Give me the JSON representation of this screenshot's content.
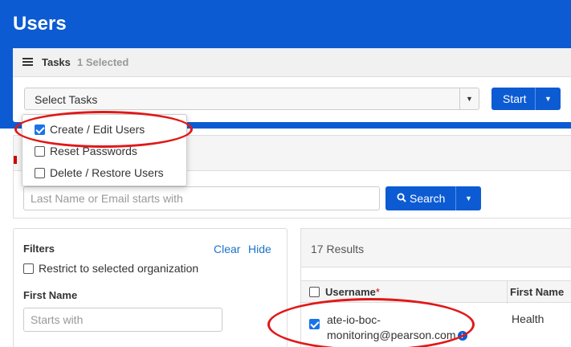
{
  "page": {
    "title": "Users"
  },
  "tasks": {
    "label": "Tasks",
    "selected_count": "1 Selected",
    "select_placeholder": "Select Tasks",
    "start_label": "Start",
    "menu": [
      {
        "label": "Create / Edit Users",
        "checked": true
      },
      {
        "label": "Reset Passwords",
        "checked": false
      },
      {
        "label": "Delete / Restore Users",
        "checked": false
      }
    ]
  },
  "search": {
    "placeholder": "Last Name or Email starts with",
    "button_label": "Search"
  },
  "filters": {
    "title": "Filters",
    "clear_label": "Clear",
    "hide_label": "Hide",
    "restrict_label": "Restrict to selected organization",
    "first_name_title": "First Name",
    "first_name_placeholder": "Starts with"
  },
  "results": {
    "count_label": "17 Results",
    "columns": {
      "username": "Username",
      "username_required": "*",
      "first_name": "First Name"
    },
    "rows": [
      {
        "username_line1": "ate-io-boc-",
        "username_line2": "monitoring@pearson.com",
        "first_name": "Health",
        "checked": true
      }
    ]
  },
  "colors": {
    "brand_blue": "#0c5bd3",
    "annotation_red": "#e01818",
    "link_blue": "#1a73c8"
  }
}
